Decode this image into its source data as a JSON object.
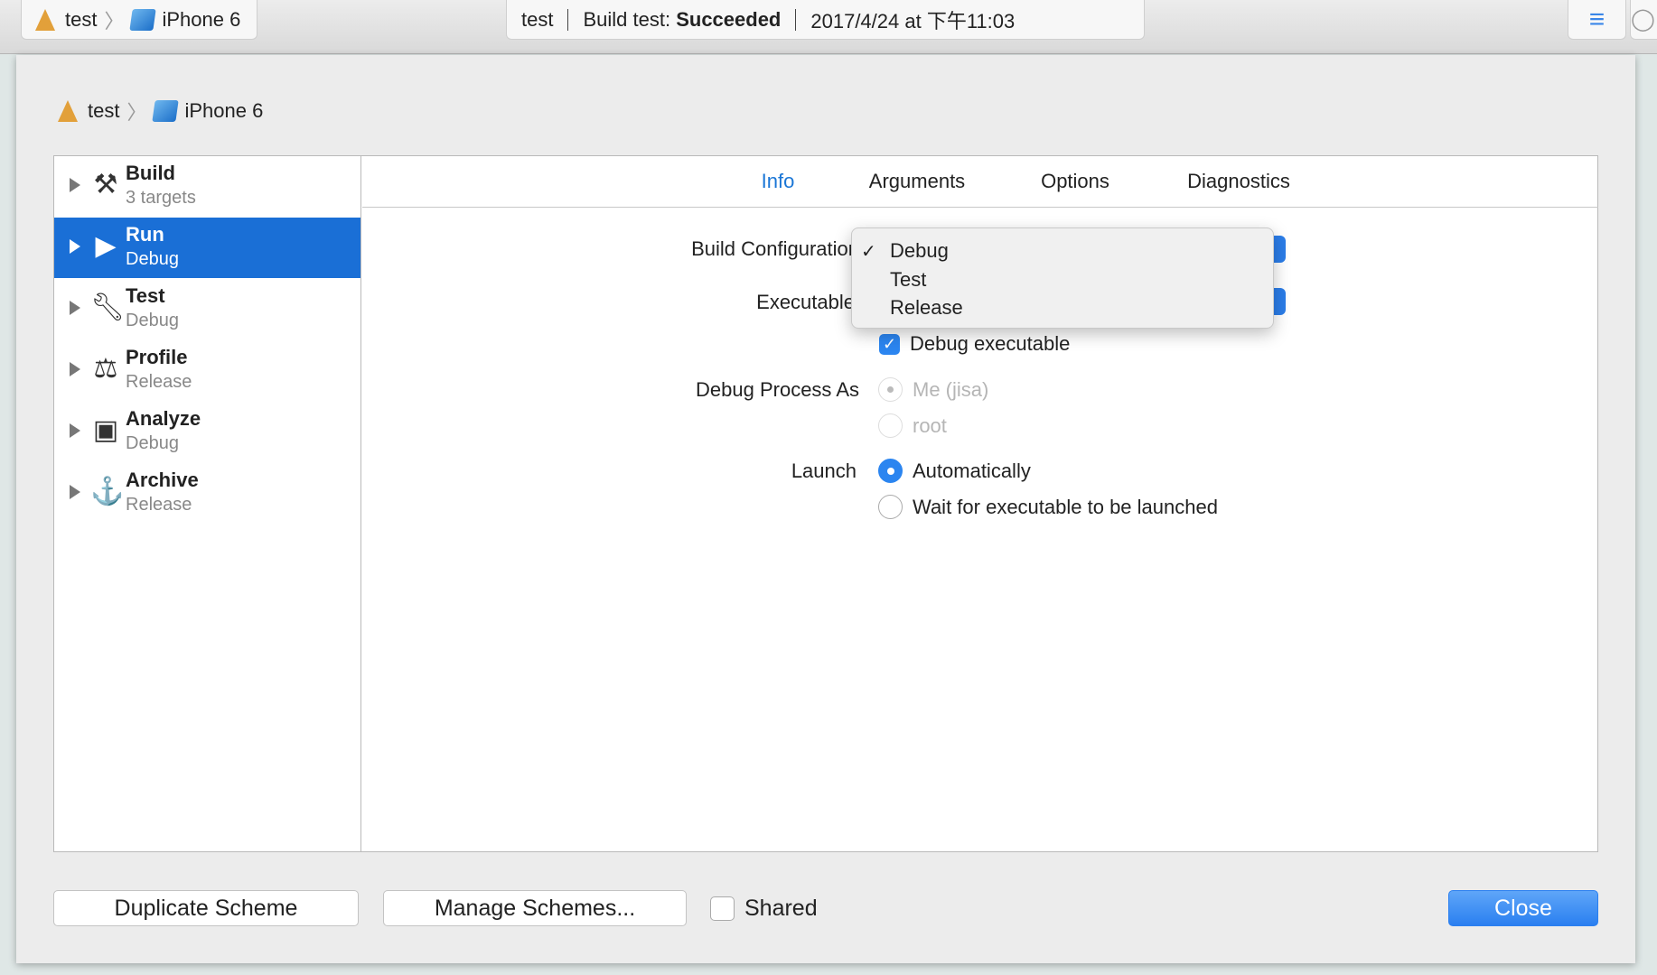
{
  "toolbar": {
    "project": "test",
    "device": "iPhone 6",
    "status_project": "test",
    "status_prefix": "Build test:",
    "status_result": "Succeeded",
    "status_time": "2017/4/24 at 下午11:03"
  },
  "sheet": {
    "project": "test",
    "device": "iPhone 6"
  },
  "sidebar": {
    "items": [
      {
        "title": "Build",
        "subtitle": "3 targets",
        "icon": "hammer-icon"
      },
      {
        "title": "Run",
        "subtitle": "Debug",
        "icon": "play-icon"
      },
      {
        "title": "Test",
        "subtitle": "Debug",
        "icon": "wrench-icon"
      },
      {
        "title": "Profile",
        "subtitle": "Release",
        "icon": "instruments-icon"
      },
      {
        "title": "Analyze",
        "subtitle": "Debug",
        "icon": "analyze-icon"
      },
      {
        "title": "Archive",
        "subtitle": "Release",
        "icon": "archive-icon"
      }
    ]
  },
  "tabs": [
    "Info",
    "Arguments",
    "Options",
    "Diagnostics"
  ],
  "active_tab": "Info",
  "form": {
    "build_config_label": "Build Configuration",
    "executable_label": "Executable",
    "debug_exec": "Debug executable",
    "debug_exec_checked": true,
    "process_label": "Debug Process As",
    "process_opt1": "Me (jisa)",
    "process_opt2": "root",
    "launch_label": "Launch",
    "launch_opt1": "Automatically",
    "launch_opt2": "Wait for executable to be launched"
  },
  "menu": {
    "check": "✓",
    "items": [
      "Debug",
      "Test",
      "Release"
    ],
    "selected": "Debug"
  },
  "footer": {
    "duplicate": "Duplicate Scheme",
    "manage": "Manage Schemes...",
    "shared": "Shared",
    "shared_checked": false,
    "close": "Close"
  },
  "colors": {
    "accent": "#1a6fd6"
  }
}
